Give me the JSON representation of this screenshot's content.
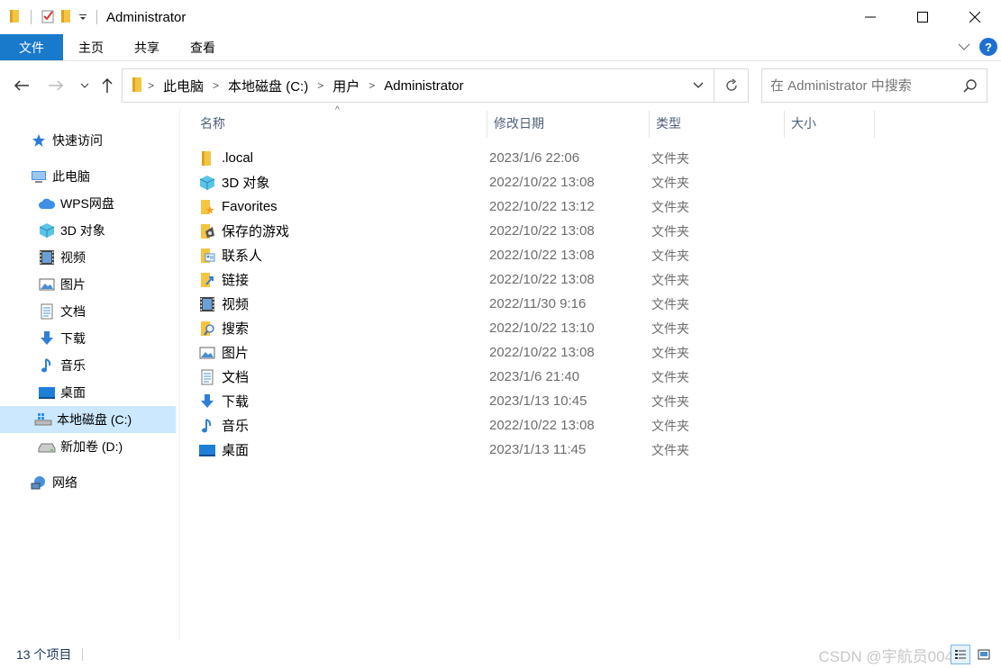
{
  "window": {
    "title": "Administrator"
  },
  "ribbon": {
    "tabs": [
      "文件",
      "主页",
      "共享",
      "查看"
    ]
  },
  "address": {
    "crumbs": [
      "此电脑",
      "本地磁盘 (C:)",
      "用户",
      "Administrator"
    ]
  },
  "search": {
    "placeholder": "在 Administrator 中搜索"
  },
  "nav": {
    "quick_access": "快速访问",
    "this_pc": "此电脑",
    "items": [
      "WPS网盘",
      "3D 对象",
      "视频",
      "图片",
      "文档",
      "下载",
      "音乐",
      "桌面",
      "本地磁盘 (C:)",
      "新加卷 (D:)"
    ],
    "network": "网络"
  },
  "columns": {
    "name": "名称",
    "date": "修改日期",
    "type": "类型",
    "size": "大小"
  },
  "files": [
    {
      "name": ".local",
      "date": "2023/1/6 22:06",
      "type": "文件夹",
      "icon": "folder-icon"
    },
    {
      "name": "3D 对象",
      "date": "2022/10/22 13:08",
      "type": "文件夹",
      "icon": "cube-3d-icon"
    },
    {
      "name": "Favorites",
      "date": "2022/10/22 13:12",
      "type": "文件夹",
      "icon": "favorites-folder-icon"
    },
    {
      "name": "保存的游戏",
      "date": "2022/10/22 13:08",
      "type": "文件夹",
      "icon": "saved-games-icon"
    },
    {
      "name": "联系人",
      "date": "2022/10/22 13:08",
      "type": "文件夹",
      "icon": "contacts-icon"
    },
    {
      "name": "链接",
      "date": "2022/10/22 13:08",
      "type": "文件夹",
      "icon": "links-icon"
    },
    {
      "name": "视频",
      "date": "2022/11/30 9:16",
      "type": "文件夹",
      "icon": "video-icon"
    },
    {
      "name": "搜索",
      "date": "2022/10/22 13:10",
      "type": "文件夹",
      "icon": "searches-icon"
    },
    {
      "name": "图片",
      "date": "2022/10/22 13:08",
      "type": "文件夹",
      "icon": "pictures-icon"
    },
    {
      "name": "文档",
      "date": "2023/1/6 21:40",
      "type": "文件夹",
      "icon": "documents-icon"
    },
    {
      "name": "下载",
      "date": "2023/1/13 10:45",
      "type": "文件夹",
      "icon": "download-icon"
    },
    {
      "name": "音乐",
      "date": "2022/10/22 13:08",
      "type": "文件夹",
      "icon": "music-icon"
    },
    {
      "name": "桌面",
      "date": "2023/1/13 11:45",
      "type": "文件夹",
      "icon": "desktop-icon"
    }
  ],
  "status": {
    "count": "13 个项目"
  },
  "watermark": "CSDN @宇航员004号",
  "colors": {
    "file_tab": "#1979ca",
    "selected": "#cce8ff",
    "folder": "#f4c542"
  }
}
